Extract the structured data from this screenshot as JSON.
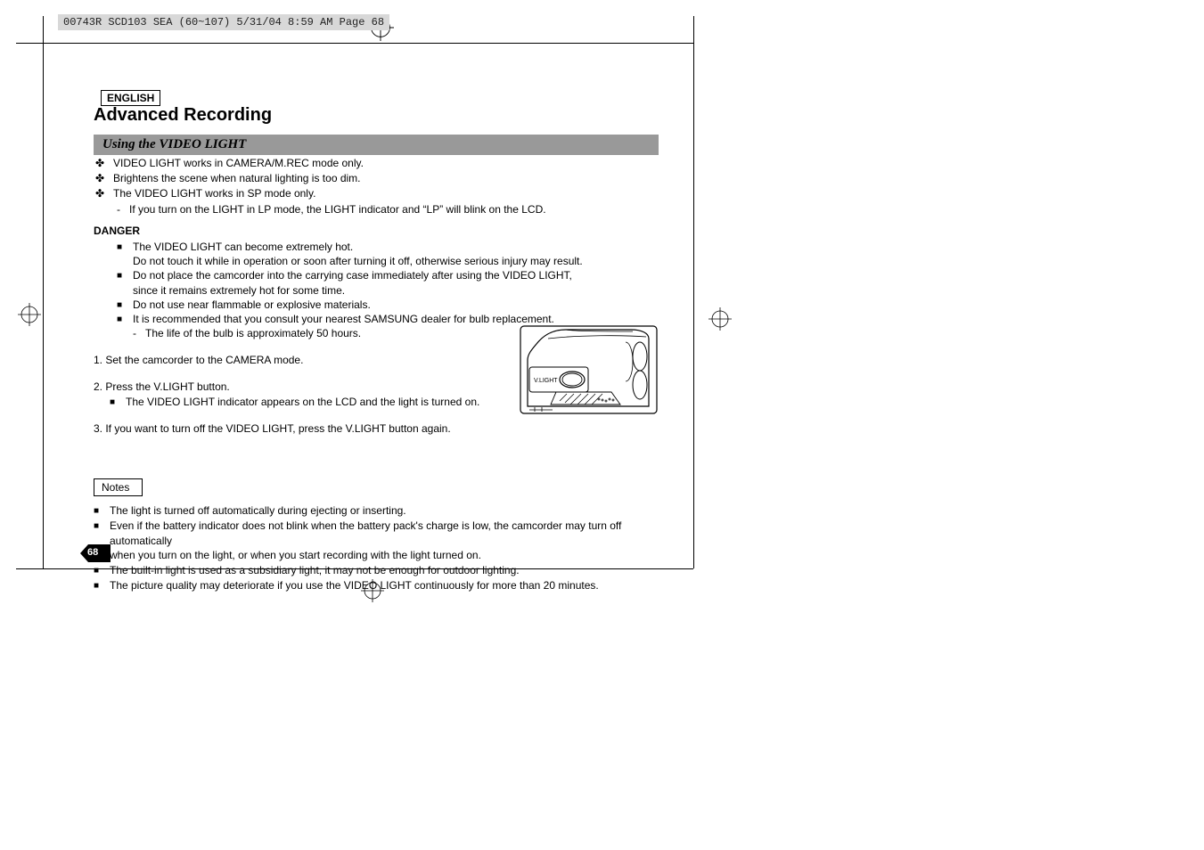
{
  "printHeader": "00743R SCD103 SEA (60~107)  5/31/04 8:59 AM  Page 68",
  "language": "ENGLISH",
  "sectionTitle": "Advanced Recording",
  "subtitle": "Using the VIDEO LIGHT",
  "intro": {
    "i1": "VIDEO LIGHT works in CAMERA/M.REC mode only.",
    "i2": "Brightens the scene when natural lighting is too dim.",
    "i3": "The VIDEO LIGHT works in SP mode only.",
    "i3a": "If you turn on the LIGHT in LP mode, the LIGHT indicator and “LP” will blink on the LCD."
  },
  "dangerLabel": "DANGER",
  "danger": {
    "d1a": "The VIDEO LIGHT can become extremely hot.",
    "d1b": "Do not touch it while in operation or soon after turning it off, otherwise serious injury may result.",
    "d2a": "Do not place the camcorder into the carrying case immediately after using the VIDEO LIGHT,",
    "d2b": "since it remains extremely hot for some time.",
    "d3": "Do not use near flammable or explosive materials.",
    "d4": "It is recommended that you consult your nearest SAMSUNG dealer for bulb replacement.",
    "d4a": "The life of the bulb is approximately 50 hours."
  },
  "steps": {
    "s1": "1.  Set the camcorder to the CAMERA mode.",
    "s2": "2.  Press the V.LIGHT button.",
    "s2a": "The VIDEO LIGHT indicator appears on the LCD and the light is turned on.",
    "s3": "3.  If you want to turn off the VIDEO LIGHT, press the V.LIGHT button again."
  },
  "notesLabel": "Notes",
  "notes": {
    "n1": "The light is turned off automatically during ejecting or inserting.",
    "n2a": "Even if the battery indicator does not blink when the battery pack's charge is low, the camcorder may turn off automatically",
    "n2b": "when you turn on the light, or when you start recording with the light turned on.",
    "n3": "The built-in light is used as a subsidiary light, it may not be enough for outdoor lighting.",
    "n4": "The picture quality may deteriorate if you use the VIDEO LIGHT continuously for more than 20 minutes."
  },
  "diagramLabel": "V.LIGHT",
  "pageNumber": "68"
}
